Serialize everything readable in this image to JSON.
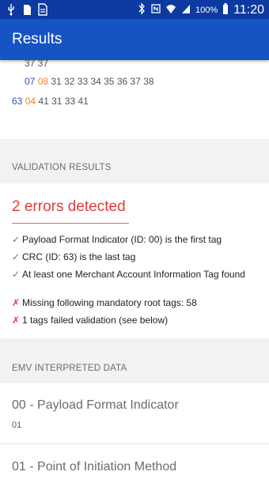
{
  "status_bar": {
    "time": "11:20",
    "battery": "100%"
  },
  "app_bar": {
    "title": "Results"
  },
  "payload_view": {
    "lines": [
      {
        "tag": "",
        "length": "",
        "value": "37 37"
      },
      {
        "tag": "07",
        "length": "08",
        "value": "31 32 33 34 35 36 37 38"
      },
      {
        "tag": "63",
        "length": "04",
        "value": "41 31 33 41"
      }
    ]
  },
  "validation": {
    "header": "VALIDATION RESULTS",
    "summary": "2 errors detected",
    "items": [
      {
        "ok": true,
        "mark": "✓",
        "text": "Payload Format Indicator (ID: 00) is the first tag"
      },
      {
        "ok": true,
        "mark": "✓",
        "text": "CRC (ID: 63) is the last tag"
      },
      {
        "ok": true,
        "mark": "✓",
        "text": "At least one Merchant Account Information Tag found"
      },
      {
        "ok": false,
        "mark": "✗",
        "text": "Missing following mandatory root tags: 58"
      },
      {
        "ok": false,
        "mark": "✗",
        "text": "1 tags failed validation (see below)"
      }
    ]
  },
  "emv": {
    "header": "EMV INTERPRETED DATA",
    "entries": [
      {
        "title": "00 - Payload Format Indicator",
        "value": "01"
      },
      {
        "title": "01 - Point of Initiation Method",
        "value": ""
      }
    ]
  },
  "colors": {
    "status_bar": "#0d3aa0",
    "app_bar": "#1654c4",
    "error": "#e33b3b",
    "success": "#2fa24b",
    "tag_blue": "#2a57b8",
    "length_orange": "#f07d2d"
  }
}
